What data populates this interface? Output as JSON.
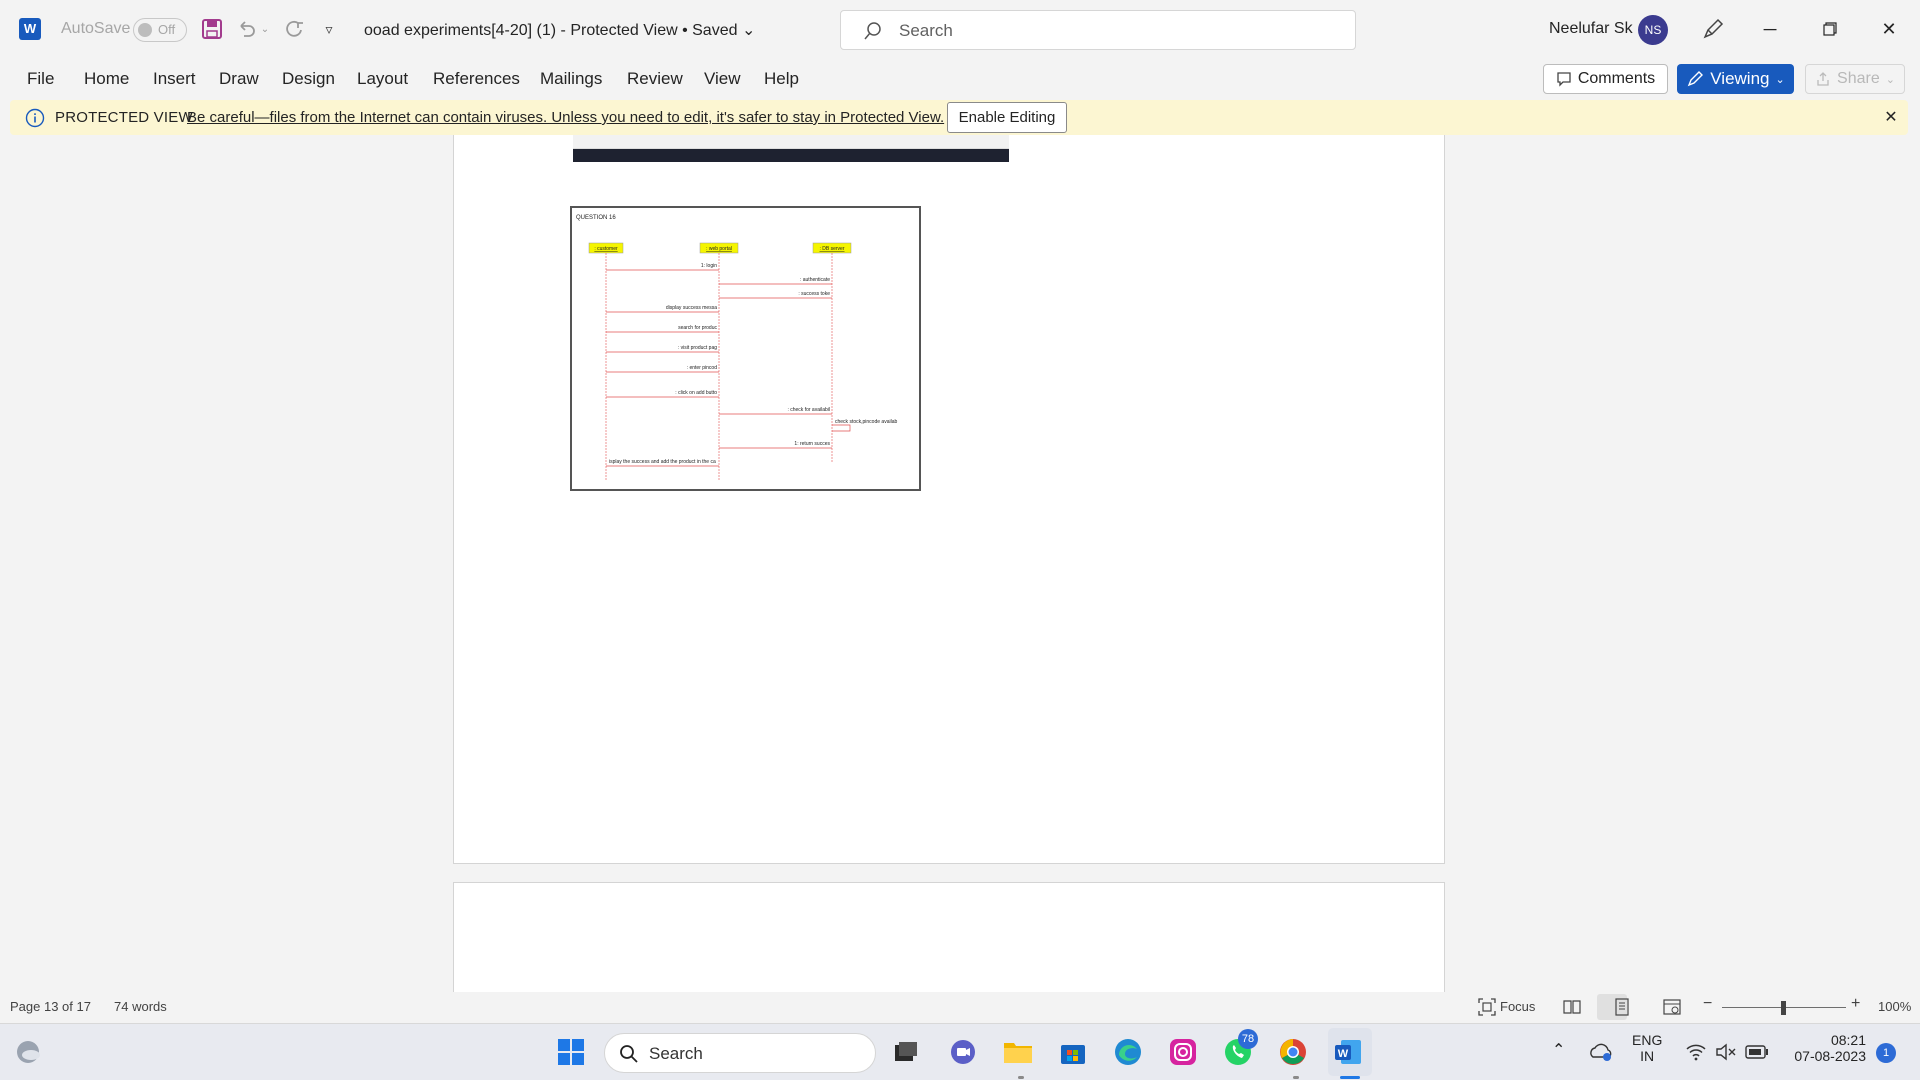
{
  "titlebar": {
    "autosave_label": "AutoSave",
    "autosave_state": "Off",
    "document_title": "ooad experiments[4-20] (1)  -  Protected View • Saved",
    "search_placeholder": "Search",
    "user_name": "Neelufar Sk",
    "user_initials": "NS"
  },
  "ribbon": {
    "tabs": [
      "File",
      "Home",
      "Insert",
      "Draw",
      "Design",
      "Layout",
      "References",
      "Mailings",
      "Review",
      "View",
      "Help"
    ],
    "comments_label": "Comments",
    "viewing_label": "Viewing",
    "share_label": "Share"
  },
  "protected_view": {
    "title": "PROTECTED VIEW",
    "message": "Be careful—files from the Internet can contain viruses. Unless you need to edit, it's safer to stay in Protected View.",
    "enable_label": "Enable Editing"
  },
  "diagram": {
    "heading": "QUESTION 16",
    "lifelines": [
      ": customer",
      ": web portal",
      ": DB server"
    ],
    "messages": [
      "1: login",
      ": authenticate",
      ": success toke",
      "display success messa",
      "search for produc",
      ": visit product pag",
      ": enter pincod",
      ": click on add butto",
      ": check for availabil",
      "check stock,pincode availab",
      "1: return succes",
      "isplay the success and add the product in the ca"
    ]
  },
  "statusbar": {
    "page": "Page 13 of 17",
    "words": "74 words",
    "focus_label": "Focus",
    "zoom": "100%"
  },
  "taskbar": {
    "search_placeholder": "Search",
    "whatsapp_badge": "78",
    "lang_top": "ENG",
    "lang_bottom": "IN",
    "time": "08:21",
    "date": "07-08-2023",
    "notifications": "1"
  },
  "colors": {
    "word_blue": "#185abd",
    "protected_bar": "#fcf6d2",
    "lifeline_yellow": "#f5f500",
    "message_red": "#e05050"
  }
}
